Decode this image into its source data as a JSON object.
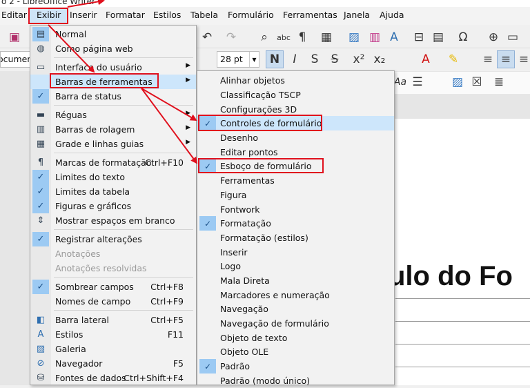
{
  "window": {
    "title": "o 2 - LibreOffice Writer"
  },
  "menubar": [
    "Editar",
    "Exibir",
    "Inserir",
    "Formatar",
    "Estilos",
    "Tabela",
    "Formulário",
    "Ferramentas",
    "Janela",
    "Ajuda"
  ],
  "toolbar": {
    "document_label": "ocumen",
    "font_size": "28 pt"
  },
  "document": {
    "heading_fragment": "ulo do Fo"
  },
  "view_menu": {
    "items": [
      {
        "label": "Normal"
      },
      {
        "label": "Como página web"
      },
      {
        "label": "Interface do usuário"
      },
      {
        "label": "Barras de ferramentas"
      },
      {
        "label": "Barra de status"
      },
      {
        "label": "Réguas"
      },
      {
        "label": "Barras de rolagem"
      },
      {
        "label": "Grade e linhas guias"
      },
      {
        "label": "Marcas de formatação",
        "shortcut": "Ctrl+F10"
      },
      {
        "label": "Limites do texto"
      },
      {
        "label": "Limites da tabela"
      },
      {
        "label": "Figuras e gráficos"
      },
      {
        "label": "Mostrar espaços em branco"
      },
      {
        "label": "Registrar alterações"
      },
      {
        "label": "Anotações"
      },
      {
        "label": "Anotações resolvidas"
      },
      {
        "label": "Sombrear campos",
        "shortcut": "Ctrl+F8"
      },
      {
        "label": "Nomes de campo",
        "shortcut": "Ctrl+F9"
      },
      {
        "label": "Barra lateral",
        "shortcut": "Ctrl+F5"
      },
      {
        "label": "Estilos",
        "shortcut": "F11"
      },
      {
        "label": "Galeria"
      },
      {
        "label": "Navegador",
        "shortcut": "F5"
      },
      {
        "label": "Fontes de dados",
        "shortcut": "Ctrl+Shift+F4"
      }
    ]
  },
  "toolbars_submenu": {
    "items": [
      {
        "label": "Alinhar objetos"
      },
      {
        "label": "Classificação TSCP"
      },
      {
        "label": "Configurações 3D"
      },
      {
        "label": "Controles de formulário"
      },
      {
        "label": "Desenho"
      },
      {
        "label": "Editar pontos"
      },
      {
        "label": "Esboço de formulário"
      },
      {
        "label": "Ferramentas"
      },
      {
        "label": "Figura"
      },
      {
        "label": "Fontwork"
      },
      {
        "label": "Formatação"
      },
      {
        "label": "Formatação (estilos)"
      },
      {
        "label": "Inserir"
      },
      {
        "label": "Logo"
      },
      {
        "label": "Mala Direta"
      },
      {
        "label": "Marcadores e numeração"
      },
      {
        "label": "Navegação"
      },
      {
        "label": "Navegação de formulário"
      },
      {
        "label": "Objeto de texto"
      },
      {
        "label": "Objeto OLE"
      },
      {
        "label": "Padrão"
      },
      {
        "label": "Padrão (modo único)"
      }
    ]
  },
  "checkmark": "✓",
  "submenu_arrow": "▶",
  "colors": {
    "highlight": "#cde6fb",
    "check_bg": "#9ccaf3",
    "annotation": "#e0101d"
  }
}
